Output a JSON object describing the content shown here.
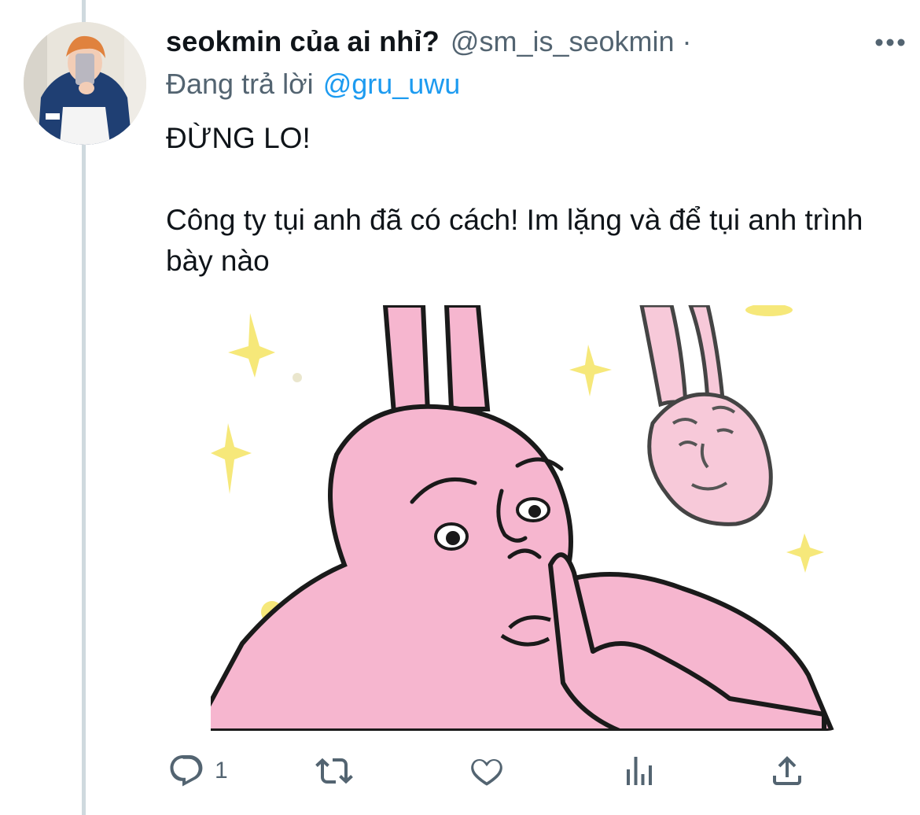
{
  "tweet": {
    "display_name": "seokmin của ai nhỉ?",
    "handle": "@sm_is_seokmin",
    "separator": "·",
    "replying_prefix": "Đang trả lời",
    "replying_to": "@gru_uwu",
    "text_line_1": "ĐỪNG LO!",
    "text_line_2": "Công ty tụi anh đã có cách! Im lặng và để tụi anh trình bày nào",
    "media_description_icon": "pink-rabbit-meme"
  },
  "actions": {
    "reply_icon": "reply-icon",
    "reply_count": "1",
    "retweet_icon": "retweet-icon",
    "like_icon": "heart-icon",
    "analytics_icon": "analytics-icon",
    "share_icon": "share-icon"
  },
  "colors": {
    "text_primary": "#0f1419",
    "text_secondary": "#536471",
    "link": "#1d9bf0",
    "thread_line": "#cfd9de",
    "rabbit_pink": "#f6b6cf",
    "sparkle": "#f5e66b"
  }
}
